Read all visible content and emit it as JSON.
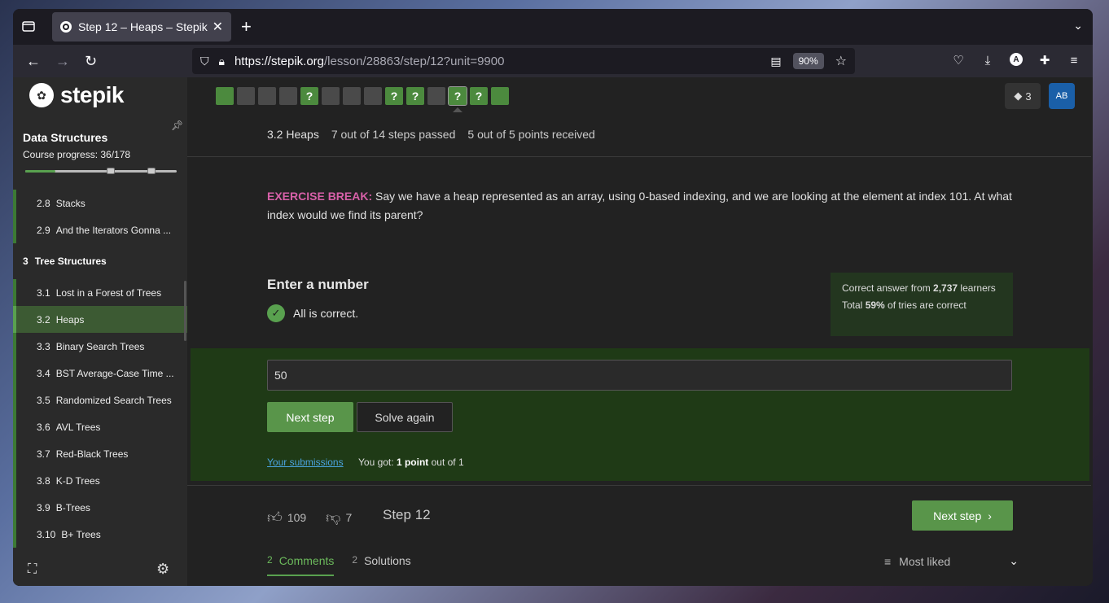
{
  "browser": {
    "tab_title": "Step 12 – Heaps – Stepik",
    "url_host": "https://stepik.org",
    "url_path": "/lesson/28863/step/12?unit=9900",
    "zoom": "90%"
  },
  "sidebar": {
    "logo": "stepik",
    "course_title": "Data Structures",
    "course_progress": "Course progress:  36/178",
    "progress_fraction": 0.2,
    "items": [
      {
        "num": "2.8",
        "label": "Stacks",
        "type": "lesson"
      },
      {
        "num": "2.9",
        "label": "And the Iterators Gonna ...",
        "type": "lesson"
      },
      {
        "num": "3",
        "label": "Tree Structures",
        "type": "section"
      },
      {
        "num": "3.1",
        "label": "Lost in a Forest of Trees",
        "type": "lesson"
      },
      {
        "num": "3.2",
        "label": "Heaps",
        "type": "lesson"
      },
      {
        "num": "3.3",
        "label": "Binary Search Trees",
        "type": "lesson"
      },
      {
        "num": "3.4",
        "label": "BST Average-Case Time ...",
        "type": "lesson"
      },
      {
        "num": "3.5",
        "label": "Randomized Search Trees",
        "type": "lesson"
      },
      {
        "num": "3.6",
        "label": "AVL Trees",
        "type": "lesson"
      },
      {
        "num": "3.7",
        "label": "Red-Black Trees",
        "type": "lesson"
      },
      {
        "num": "3.8",
        "label": "K-D Trees",
        "type": "lesson"
      },
      {
        "num": "3.9",
        "label": "B-Trees",
        "type": "lesson"
      },
      {
        "num": "3.10",
        "label": "B+ Trees",
        "type": "lesson"
      }
    ]
  },
  "header": {
    "xp": "3",
    "avatar": "AB",
    "steps": [
      "passed",
      "gray",
      "gray",
      "gray",
      "q",
      "gray",
      "gray",
      "gray",
      "q",
      "q",
      "gray",
      "q",
      "q",
      "passed"
    ]
  },
  "lesson_info": {
    "title": "3.2 Heaps",
    "steps_passed": "7 out of 14 steps passed",
    "points": "5 out of 5 points  received"
  },
  "question": {
    "tag": "EXERCISE BREAK:",
    "text": " Say we have a heap represented as an array, using 0-based indexing, and we are looking at the element at index 101. At what index would we find its parent?"
  },
  "answer": {
    "heading": "Enter a number",
    "status": "All is correct.",
    "stats_line1_a": "Correct answer from ",
    "stats_line1_b": "2,737",
    "stats_line1_c": " learners",
    "stats_line2_a": "Total ",
    "stats_line2_b": "59%",
    "stats_line2_c": " of tries are correct",
    "value": "50",
    "next_label": "Next step",
    "again_label": "Solve again",
    "submissions_label": "Your submissions",
    "you_got_a": "You got: ",
    "you_got_b": "1 point",
    "you_got_c": " out of 1"
  },
  "footer": {
    "likes": "109",
    "dislikes": "7",
    "step_label": "Step 12",
    "next_label": "Next step",
    "comments_count": "2",
    "comments_label": "Comments",
    "solutions_count": "2",
    "solutions_label": "Solutions",
    "sort_label": "Most liked"
  }
}
